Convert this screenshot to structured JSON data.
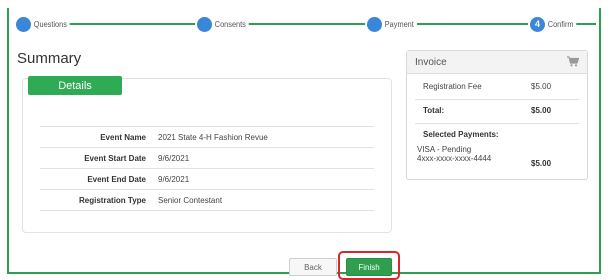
{
  "progress": {
    "steps": [
      {
        "label": "Questions",
        "number": ""
      },
      {
        "label": "Consents",
        "number": ""
      },
      {
        "label": "Payment",
        "number": ""
      },
      {
        "label": "Confirm",
        "number": "4"
      }
    ]
  },
  "summary": {
    "title": "Summary",
    "tab_label": "Details",
    "rows": [
      {
        "key": "Event Name",
        "value": "2021 State 4-H Fashion Revue"
      },
      {
        "key": "Event Start Date",
        "value": "9/6/2021"
      },
      {
        "key": "Event End Date",
        "value": "9/6/2021"
      },
      {
        "key": "Registration Type",
        "value": "Senior Contestant"
      }
    ]
  },
  "invoice": {
    "title": "Invoice",
    "fee_label": "Registration Fee",
    "fee_amount": "$5.00",
    "total_label": "Total:",
    "total_amount": "$5.00",
    "selected_label": "Selected Payments:",
    "payment_method": "VISA - Pending",
    "card_number": "4xxx-xxxx-xxxx-4444",
    "payment_amount": "$5.00"
  },
  "actions": {
    "back_label": "Back",
    "finish_label": "Finish"
  },
  "colors": {
    "accent_green": "#2f9e4f",
    "step_blue": "#3a86d8",
    "highlight_red": "#d9262b"
  }
}
